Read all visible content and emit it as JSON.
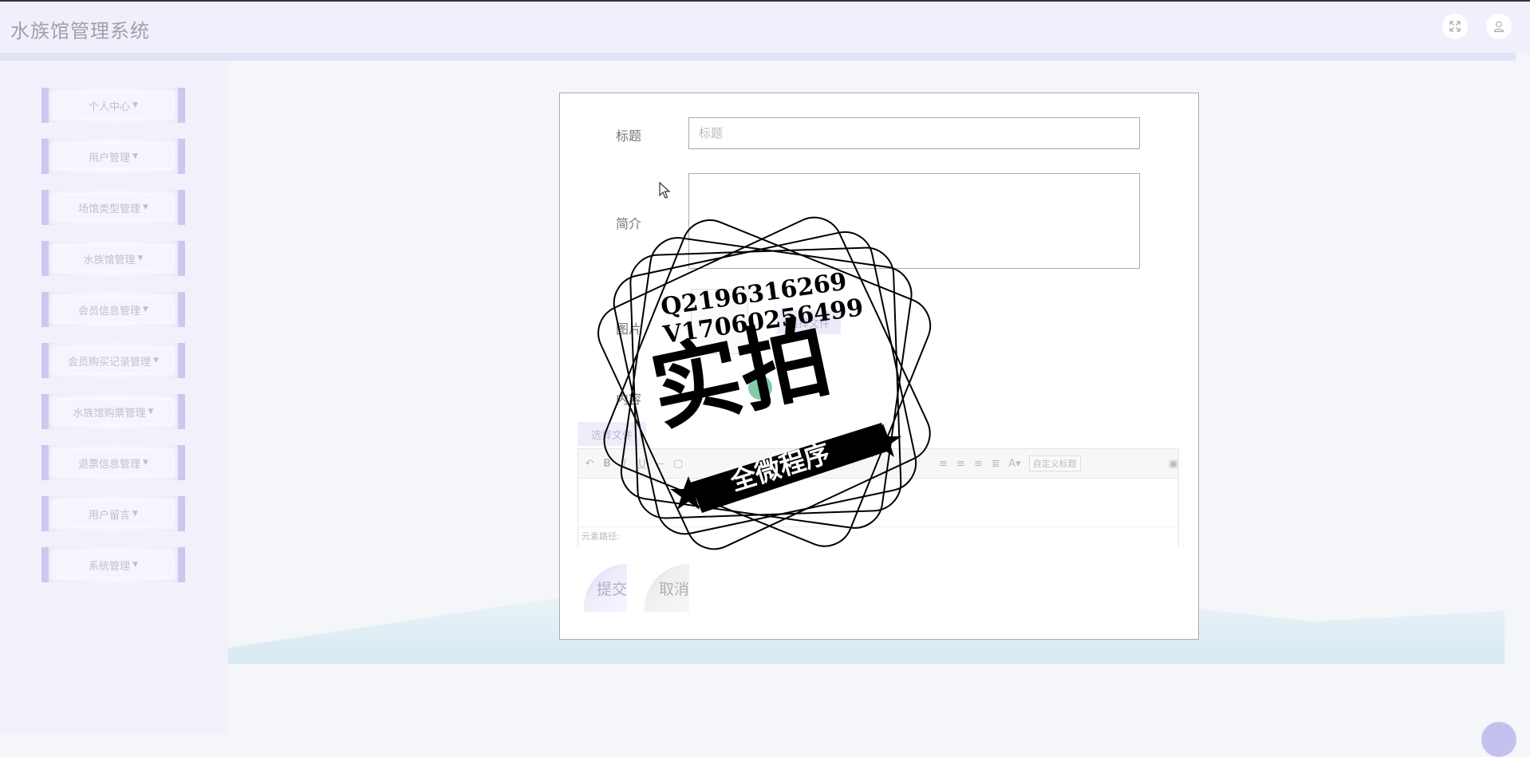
{
  "header": {
    "app_title": "水族馆管理系统",
    "fullscreen_icon": "fullscreen-icon",
    "user_icon": "user-icon"
  },
  "sidebar": {
    "items": [
      {
        "label": "个人中心"
      },
      {
        "label": "用户管理"
      },
      {
        "label": "场馆类型管理"
      },
      {
        "label": "水族馆管理"
      },
      {
        "label": "会员信息管理"
      },
      {
        "label": "会员购买记录管理"
      },
      {
        "label": "水族馆购票管理"
      },
      {
        "label": "退票信息管理"
      },
      {
        "label": "用户留言"
      },
      {
        "label": "系统管理"
      }
    ]
  },
  "form": {
    "title_label": "标题",
    "title_placeholder": "标题",
    "intro_label": "简介",
    "image_label": "图片",
    "file_button": "选择文件",
    "content_label": "内容",
    "editor_tab": "选择文件",
    "custom_heading": "自定义标题",
    "editor_status": "元素路径:",
    "submit_label": "提交",
    "cancel_label": "取消"
  },
  "watermark": {
    "line1": "Q2196316269",
    "line2": "V17060256499",
    "main_text": "实拍",
    "ribbon_text": "全微程序"
  },
  "colors": {
    "header_bg": "#eff0fb",
    "sidebar_bg": "#f0f1fb",
    "menu_accent": "#cbc7ef",
    "page_bg": "#f4f6f9"
  }
}
